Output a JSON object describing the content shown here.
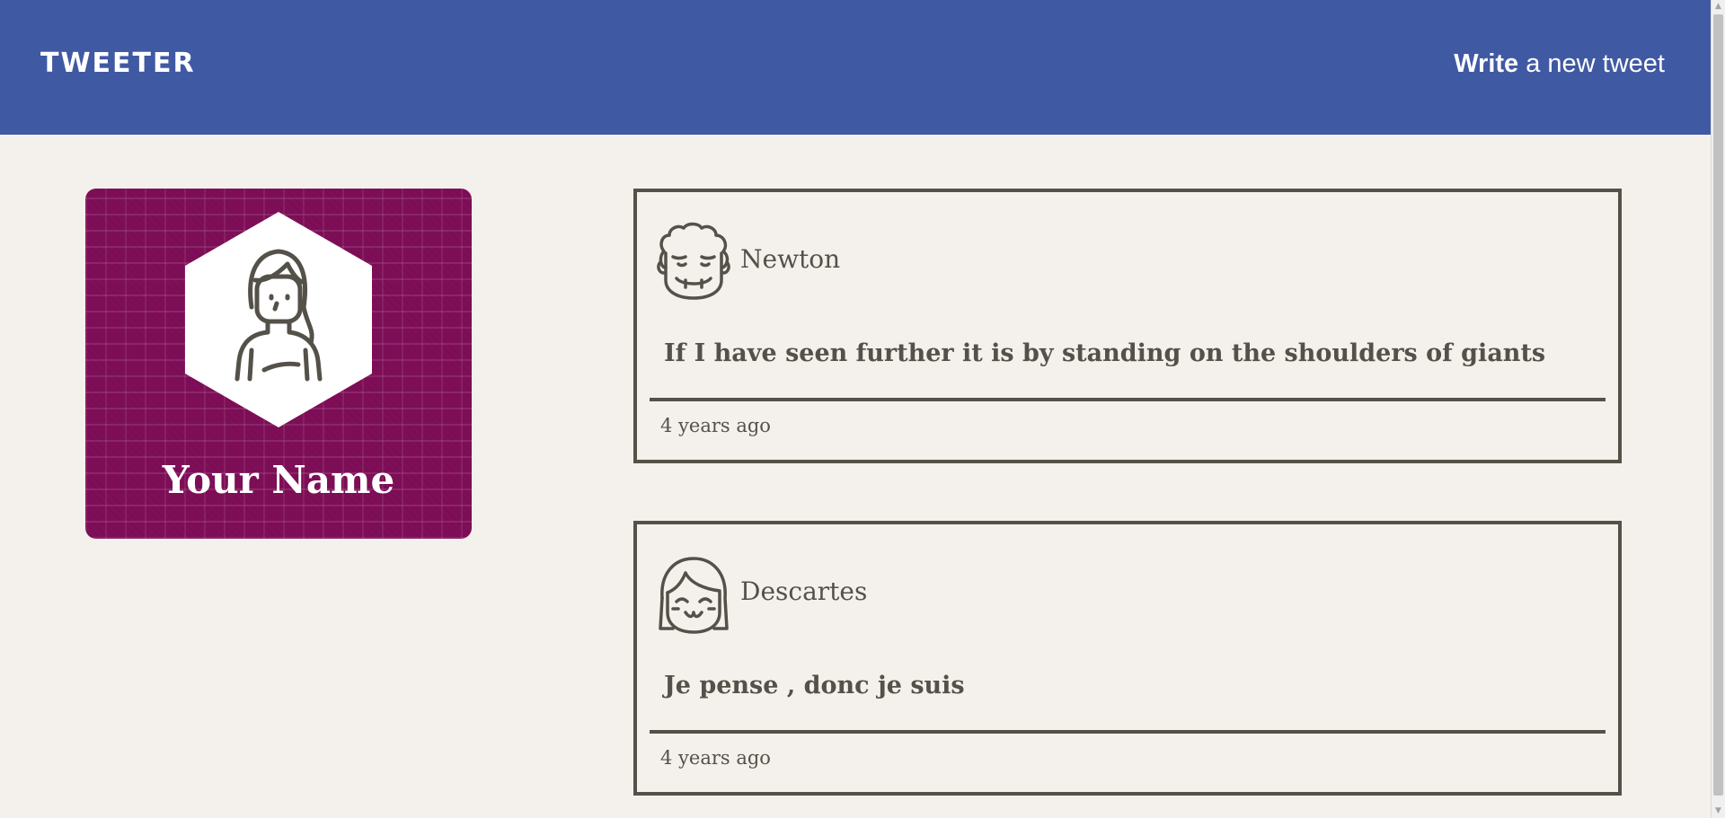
{
  "header": {
    "logo": "TWEETER",
    "compose_strong": "Write",
    "compose_rest": " a new tweet"
  },
  "profile": {
    "name": "Your Name",
    "avatar_icon": "woman-avatar-icon"
  },
  "tweets": [
    {
      "author": "Newton",
      "avatar_icon": "curly-hair-avatar-icon",
      "content": "If I have seen further it is by standing on the shoulders of giants",
      "time": "4 years ago"
    },
    {
      "author": "Descartes",
      "avatar_icon": "bob-hair-avatar-icon",
      "content": "Je pense , donc je suis",
      "time": "4 years ago"
    }
  ],
  "colors": {
    "header_bg": "#4059a3",
    "page_bg": "#f4f1ec",
    "profile_bg": "#7e0e57",
    "ink": "#545149"
  }
}
